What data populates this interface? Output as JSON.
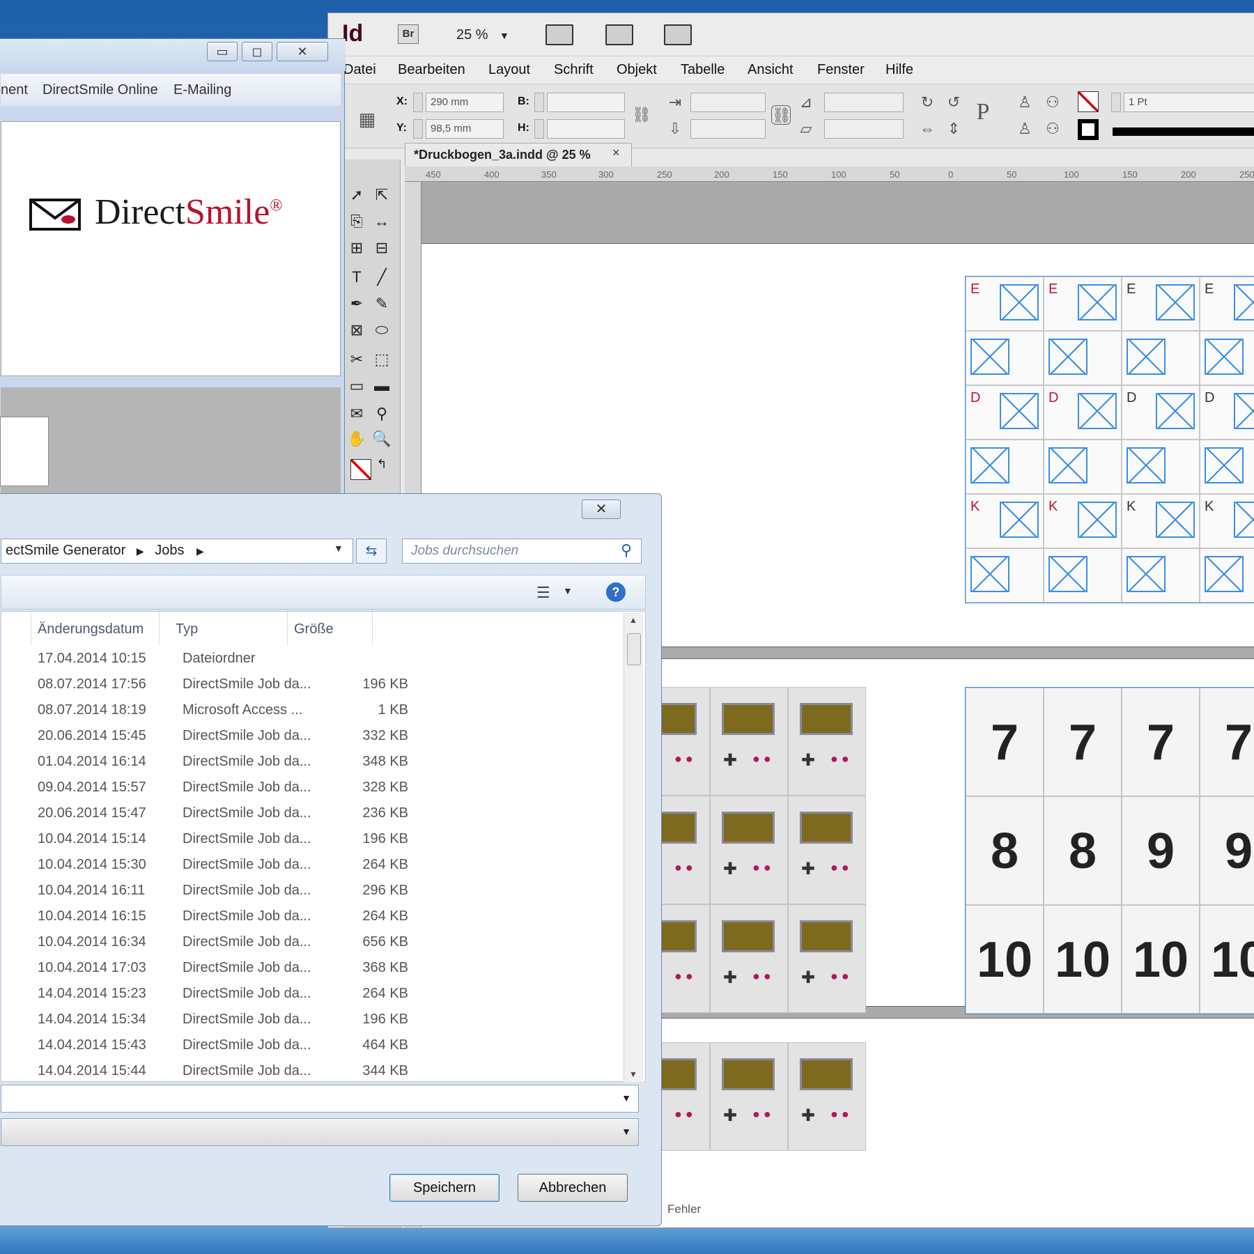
{
  "indesign": {
    "logo": "Id",
    "bridge_label": "Br",
    "zoom": "25 %",
    "menu": [
      "Datei",
      "Bearbeiten",
      "Layout",
      "Schrift",
      "Objekt",
      "Tabelle",
      "Ansicht",
      "Fenster",
      "Hilfe"
    ],
    "control": {
      "x_label": "X:",
      "x_value": "290 mm",
      "y_label": "Y:",
      "y_value": "98,5 mm",
      "b_label": "B:",
      "h_label": "H:",
      "stroke_weight": "1 Pt"
    },
    "document_tab": "*Druckbogen_3a.indd @ 25 %",
    "tab_close": "×",
    "ruler_ticks": [
      "450",
      "400",
      "350",
      "300",
      "250",
      "200",
      "150",
      "100",
      "50",
      "0",
      "50",
      "100",
      "150",
      "200",
      "250"
    ],
    "status": "Fehler"
  },
  "directsmile_window": {
    "menu": [
      "nent",
      "DirectSmile Online",
      "E-Mailing"
    ],
    "logo_direct": "Direct",
    "logo_smile": "Smile",
    "logo_reg": "®",
    "caption_buttons": [
      "▭",
      "◻",
      "✕"
    ]
  },
  "save_dialog": {
    "close": "✕",
    "breadcrumb": [
      "ectSmile Generator",
      "Jobs"
    ],
    "search_placeholder": "Jobs durchsuchen",
    "columns": {
      "date": "Änderungsdatum",
      "type": "Typ",
      "size": "Größe"
    },
    "files": [
      {
        "date": "17.04.2014 10:15",
        "type": "Dateiordner",
        "size": ""
      },
      {
        "date": "08.07.2014 17:56",
        "type": "DirectSmile Job da...",
        "size": "196 KB"
      },
      {
        "date": "08.07.2014 18:19",
        "type": "Microsoft Access ...",
        "size": "1 KB"
      },
      {
        "date": "20.06.2014 15:45",
        "type": "DirectSmile Job da...",
        "size": "332 KB"
      },
      {
        "date": "01.04.2014 16:14",
        "type": "DirectSmile Job da...",
        "size": "348 KB"
      },
      {
        "date": "09.04.2014 15:57",
        "type": "DirectSmile Job da...",
        "size": "328 KB"
      },
      {
        "date": "20.06.2014 15:47",
        "type": "DirectSmile Job da...",
        "size": "236 KB"
      },
      {
        "date": "10.04.2014 15:14",
        "type": "DirectSmile Job da...",
        "size": "196 KB"
      },
      {
        "date": "10.04.2014 15:30",
        "type": "DirectSmile Job da...",
        "size": "264 KB"
      },
      {
        "date": "10.04.2014 16:11",
        "type": "DirectSmile Job da...",
        "size": "296 KB"
      },
      {
        "date": "10.04.2014 16:15",
        "type": "DirectSmile Job da...",
        "size": "264 KB"
      },
      {
        "date": "10.04.2014 16:34",
        "type": "DirectSmile Job da...",
        "size": "656 KB"
      },
      {
        "date": "10.04.2014 17:03",
        "type": "DirectSmile Job da...",
        "size": "368 KB"
      },
      {
        "date": "14.04.2014 15:23",
        "type": "DirectSmile Job da...",
        "size": "264 KB"
      },
      {
        "date": "14.04.2014 15:34",
        "type": "DirectSmile Job da...",
        "size": "196 KB"
      },
      {
        "date": "14.04.2014 15:43",
        "type": "DirectSmile Job da...",
        "size": "464 KB"
      },
      {
        "date": "14.04.2014 15:44",
        "type": "DirectSmile Job da...",
        "size": "344 KB"
      }
    ],
    "save_label": "Speichern",
    "cancel_label": "Abbrechen"
  },
  "cards": {
    "row_labels": [
      "E",
      "D",
      "K"
    ],
    "number_rows": [
      "7",
      "8",
      "9",
      "10"
    ]
  }
}
